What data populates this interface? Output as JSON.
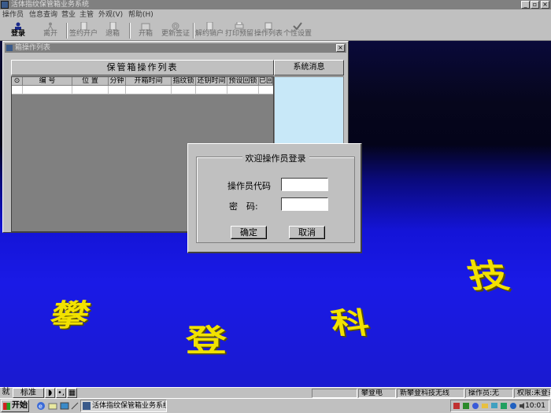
{
  "window": {
    "title": "活体指纹保管箱业务系统",
    "minimize": "_",
    "restore": "▫",
    "close": "×"
  },
  "menu": [
    "操作员",
    "信息查询",
    "营业",
    "主管",
    "外观(V)",
    "帮助(H)"
  ],
  "toolbar": {
    "login": "登录",
    "leave": "离开",
    "sign_open": "签约开户",
    "cancel_box": "退箱",
    "open_box": "开箱",
    "change_fp": "更新签证",
    "unlock_customer": "解约销户",
    "print_report": "打印预留",
    "operation_list": "操作列表",
    "personal_setting": "个性设置"
  },
  "locker_window": {
    "title": "箱操作列表",
    "list_header": "保管箱操作列表",
    "system_header": "系统消息",
    "columns": [
      "⊙",
      "编 号",
      "位 置",
      "分钟",
      "开箱时间",
      "指纹锁",
      "还钥时间",
      "预设回锁",
      "已回锁"
    ]
  },
  "login_dialog": {
    "title": "欢迎操作员登录",
    "code_label": "操作员代码",
    "password_label": "密　码:",
    "code_value": "",
    "password_value": "",
    "ok": "确定",
    "cancel": "取消"
  },
  "watermark": [
    "攀",
    "登",
    "科",
    "技"
  ],
  "status_bar": {
    "ime": [
      "就",
      "标准",
      "◗",
      "•,",
      "▦"
    ],
    "power": "攀登电",
    "company": "新攀登科技无线",
    "operator": "操作员:无",
    "permission": "权限:未登录"
  },
  "taskbar": {
    "start": "开始",
    "task": "活体指纹保管箱业务系统",
    "clock": "10:01"
  },
  "colors": {
    "watermark": "#f2e200",
    "desktop_blue": "#1a1ae6",
    "system_panel": "#c8e8f8"
  }
}
